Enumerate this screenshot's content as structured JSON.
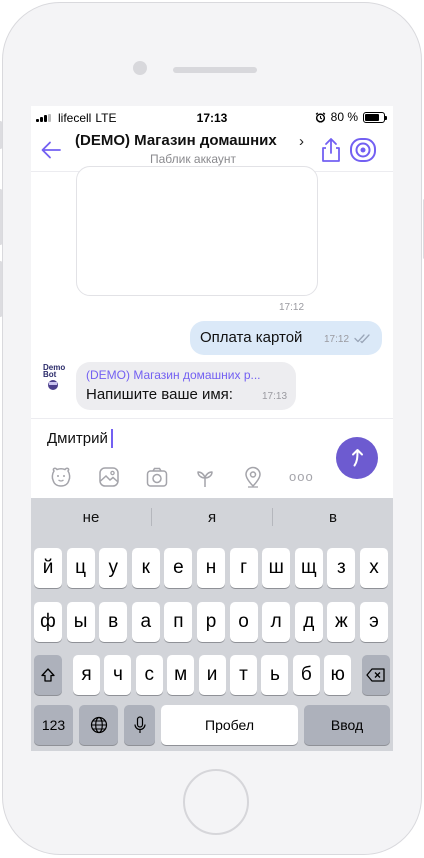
{
  "status_bar": {
    "carrier": "lifecell",
    "network": "LTE",
    "time": "17:13",
    "battery": "80 %",
    "battery_level": 0.8
  },
  "header": {
    "title": "(DEMO) Магазин домашних",
    "subtitle": "Паблик аккаунт",
    "chevron": "›"
  },
  "chat": {
    "card_time": "17:12",
    "outgoing": {
      "text": "Оплата картой",
      "time": "17:12"
    },
    "incoming": {
      "sender": "(DEMO) Магазин домашних р...",
      "text": "Напишите ваше имя:",
      "time": "17:13"
    },
    "avatar_text": "Demo Bot"
  },
  "input": {
    "value": "Дмитрий"
  },
  "toolbar": {
    "icons": [
      "sticker-icon",
      "gallery-icon",
      "camera-icon",
      "doodle-icon",
      "location-icon",
      "more-icon"
    ],
    "more_label": "ooo"
  },
  "keyboard": {
    "suggestions": [
      "не",
      "я",
      "в"
    ],
    "row1": [
      "й",
      "ц",
      "у",
      "к",
      "е",
      "н",
      "г",
      "ш",
      "щ",
      "з",
      "х"
    ],
    "row2": [
      "ф",
      "ы",
      "в",
      "а",
      "п",
      "р",
      "о",
      "л",
      "д",
      "ж",
      "э"
    ],
    "row3": [
      "я",
      "ч",
      "с",
      "м",
      "и",
      "т",
      "ь",
      "б",
      "ю"
    ],
    "numbers_label": "123",
    "space_label": "Пробел",
    "return_label": "Ввод"
  },
  "colors": {
    "accent": "#7360f2",
    "outgoing_bubble": "#dbe9f8",
    "incoming_bubble": "#ededf0",
    "keyboard_bg": "#d2d4d9"
  }
}
